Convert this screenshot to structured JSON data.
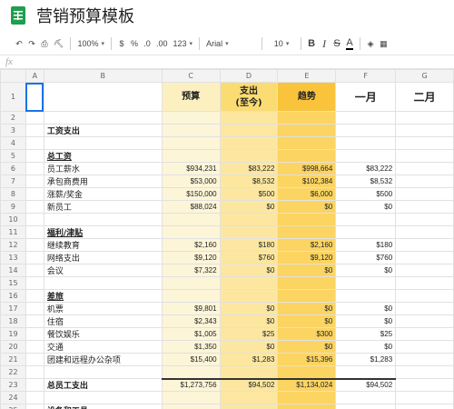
{
  "doc": {
    "title": "营销预算模板"
  },
  "toolbar": {
    "zoom": "100%",
    "currency": "$",
    "percent": "%",
    "dec_less": ".0",
    "dec_more": ".00",
    "more_formats": "123",
    "font": "Arial",
    "font_size": "10",
    "bold": "B",
    "italic": "I",
    "strike": "S",
    "text_color": "A"
  },
  "formula_bar": {
    "fx": "fx"
  },
  "columns": [
    "A",
    "B",
    "C",
    "D",
    "E",
    "F",
    "G"
  ],
  "header_row": {
    "c": "预算",
    "d_line1": "支出",
    "d_line2": "(至今)",
    "e": "趋势",
    "f": "一月",
    "g": "二月"
  },
  "rows": [
    {
      "n": "2",
      "b": "",
      "style": "",
      "c": "",
      "d": "",
      "e": "",
      "f": ""
    },
    {
      "n": "3",
      "b": "工资支出",
      "style": "bold",
      "c": "",
      "d": "",
      "e": "",
      "f": ""
    },
    {
      "n": "4",
      "b": "",
      "style": "",
      "c": "",
      "d": "",
      "e": "",
      "f": ""
    },
    {
      "n": "5",
      "b": "总工资",
      "style": "uline",
      "c": "",
      "d": "",
      "e": "",
      "f": ""
    },
    {
      "n": "6",
      "b": "员工薪水",
      "style": "",
      "c": "$934,231",
      "d": "$83,222",
      "e": "$998,664",
      "f": "$83,222"
    },
    {
      "n": "7",
      "b": "承包商费用",
      "style": "",
      "c": "$53,000",
      "d": "$8,532",
      "e": "$102,384",
      "f": "$8,532"
    },
    {
      "n": "8",
      "b": "涨薪/奖金",
      "style": "",
      "c": "$150,000",
      "d": "$500",
      "e": "$6,000",
      "f": "$500"
    },
    {
      "n": "9",
      "b": "新员工",
      "style": "",
      "c": "$88,024",
      "d": "$0",
      "e": "$0",
      "f": "$0"
    },
    {
      "n": "10",
      "b": "",
      "style": "",
      "c": "",
      "d": "",
      "e": "",
      "f": ""
    },
    {
      "n": "11",
      "b": "福利/津贴",
      "style": "uline",
      "c": "",
      "d": "",
      "e": "",
      "f": ""
    },
    {
      "n": "12",
      "b": "继续教育",
      "style": "",
      "c": "$2,160",
      "d": "$180",
      "e": "$2,160",
      "f": "$180"
    },
    {
      "n": "13",
      "b": "网络支出",
      "style": "",
      "c": "$9,120",
      "d": "$760",
      "e": "$9,120",
      "f": "$760"
    },
    {
      "n": "14",
      "b": "会议",
      "style": "",
      "c": "$7,322",
      "d": "$0",
      "e": "$0",
      "f": "$0"
    },
    {
      "n": "15",
      "b": "",
      "style": "",
      "c": "",
      "d": "",
      "e": "",
      "f": ""
    },
    {
      "n": "16",
      "b": "差旅",
      "style": "uline",
      "c": "",
      "d": "",
      "e": "",
      "f": ""
    },
    {
      "n": "17",
      "b": "机票",
      "style": "",
      "c": "$9,801",
      "d": "$0",
      "e": "$0",
      "f": "$0"
    },
    {
      "n": "18",
      "b": "住宿",
      "style": "",
      "c": "$2,343",
      "d": "$0",
      "e": "$0",
      "f": "$0"
    },
    {
      "n": "19",
      "b": "餐饮娱乐",
      "style": "",
      "c": "$1,005",
      "d": "$25",
      "e": "$300",
      "f": "$25"
    },
    {
      "n": "20",
      "b": "交通",
      "style": "",
      "c": "$1,350",
      "d": "$0",
      "e": "$0",
      "f": "$0"
    },
    {
      "n": "21",
      "b": "团建和远程办公杂项",
      "style": "",
      "c": "$15,400",
      "d": "$1,283",
      "e": "$15,396",
      "f": "$1,283"
    },
    {
      "n": "22",
      "b": "",
      "style": "",
      "c": "",
      "d": "",
      "e": "",
      "f": ""
    },
    {
      "n": "23",
      "b": "总员工支出",
      "style": "bold total",
      "c": "$1,273,756",
      "d": "$94,502",
      "e": "$1,134,024",
      "f": "$94,502"
    },
    {
      "n": "24",
      "b": "",
      "style": "",
      "c": "",
      "d": "",
      "e": "",
      "f": ""
    },
    {
      "n": "25",
      "b": "设备和工具",
      "style": "bold",
      "c": "",
      "d": "",
      "e": "",
      "f": ""
    }
  ],
  "colors": {
    "budget_col": "#fdf5d8",
    "spend_col": "#fde7a0",
    "trend_col": "#fbd462",
    "selection": "#1a73e8",
    "app_icon": "#1e9e4f"
  }
}
